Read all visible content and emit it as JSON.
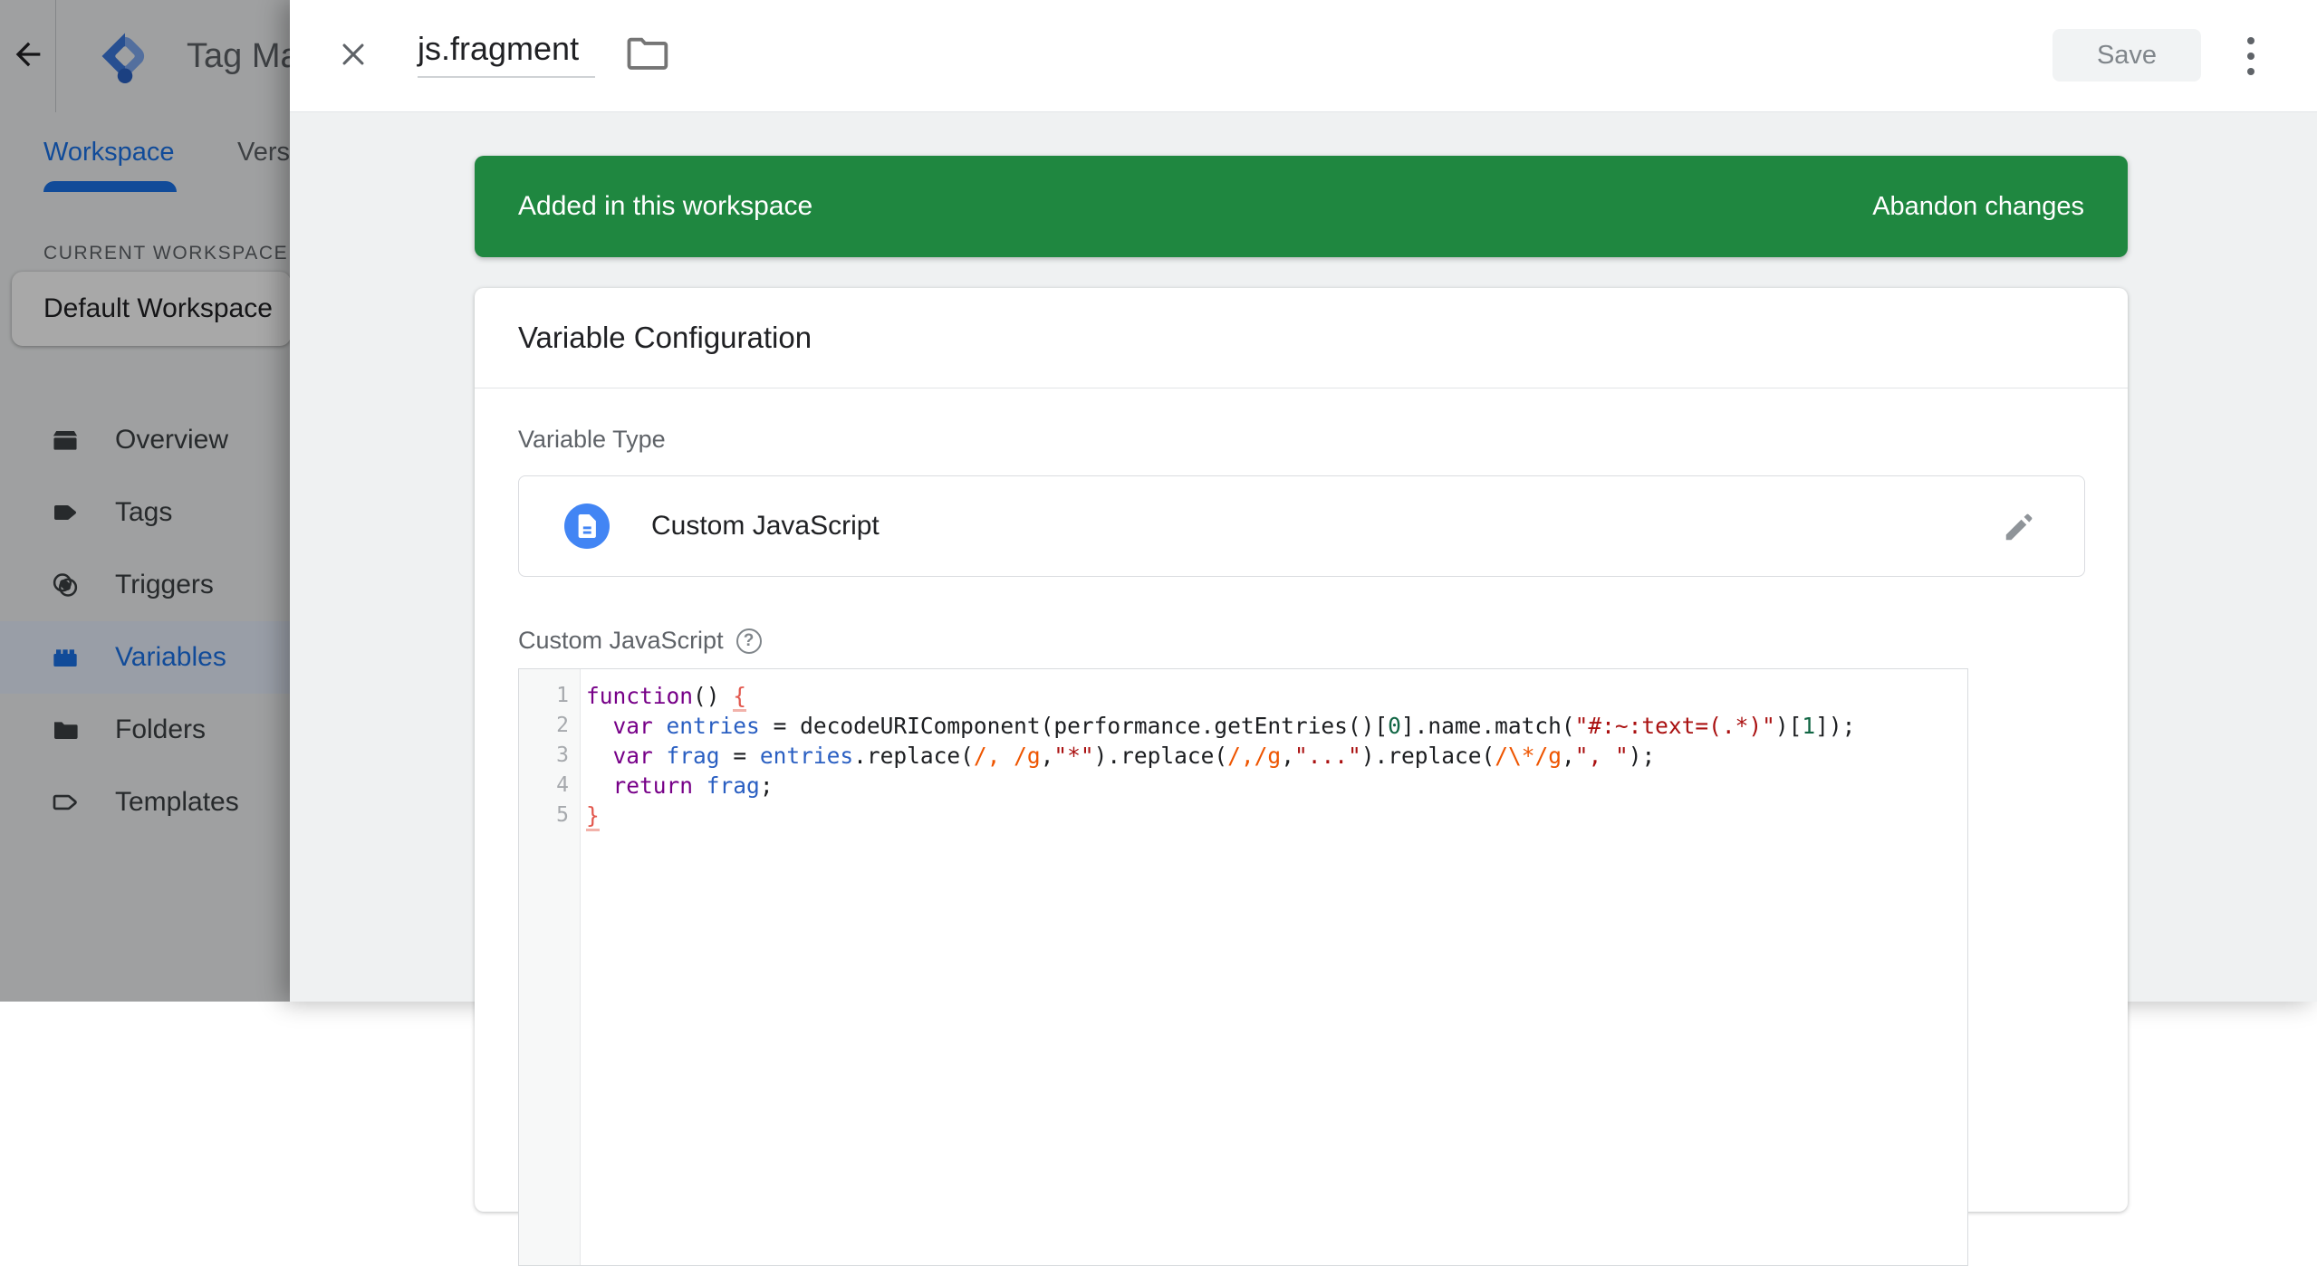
{
  "app": {
    "title": "Tag Ma",
    "tabs": [
      {
        "label": "Workspace",
        "active": true
      },
      {
        "label": "Vers",
        "active": false
      }
    ],
    "sidebar": {
      "section_label": "CURRENT WORKSPACE",
      "workspace_name": "Default Workspace",
      "items": [
        {
          "label": "Overview",
          "selected": false
        },
        {
          "label": "Tags",
          "selected": false
        },
        {
          "label": "Triggers",
          "selected": false
        },
        {
          "label": "Variables",
          "selected": true
        },
        {
          "label": "Folders",
          "selected": false
        },
        {
          "label": "Templates",
          "selected": false
        }
      ]
    }
  },
  "panel": {
    "title": "js.fragment",
    "save_label": "Save",
    "banner": {
      "message": "Added in this workspace",
      "action_label": "Abandon changes"
    },
    "card_title": "Variable Configuration",
    "variable_type": {
      "label": "Variable Type",
      "value": "Custom JavaScript"
    },
    "editor": {
      "label": "Custom JavaScript",
      "lines": [
        {
          "num": 1,
          "tokens": [
            [
              "k",
              "function"
            ],
            [
              "p",
              "() "
            ],
            [
              "b",
              "{"
            ]
          ]
        },
        {
          "num": 2,
          "tokens": [
            [
              "p",
              "  "
            ],
            [
              "k",
              "var"
            ],
            [
              "p",
              " "
            ],
            [
              "v",
              "entries"
            ],
            [
              "p",
              " = decodeURIComponent(performance.getEntries()["
            ],
            [
              "n",
              "0"
            ],
            [
              "p",
              "].name.match("
            ],
            [
              "s",
              "\"#:~:text=(.*)\""
            ],
            [
              "p",
              ")["
            ],
            [
              "n",
              "1"
            ],
            [
              "p",
              "]);"
            ]
          ]
        },
        {
          "num": 3,
          "tokens": [
            [
              "p",
              "  "
            ],
            [
              "k",
              "var"
            ],
            [
              "p",
              " "
            ],
            [
              "v",
              "frag"
            ],
            [
              "p",
              " = "
            ],
            [
              "v",
              "entries"
            ],
            [
              "p",
              ".replace("
            ],
            [
              "r",
              "/, /g"
            ],
            [
              "p",
              ","
            ],
            [
              "s",
              "\"*\""
            ],
            [
              "p",
              ").replace("
            ],
            [
              "r",
              "/,/g"
            ],
            [
              "p",
              ","
            ],
            [
              "s",
              "\"...\""
            ],
            [
              "p",
              ").replace("
            ],
            [
              "r",
              "/\\*/g"
            ],
            [
              "p",
              ","
            ],
            [
              "s",
              "\", \""
            ],
            [
              "p",
              ");"
            ]
          ]
        },
        {
          "num": 4,
          "tokens": [
            [
              "p",
              "  "
            ],
            [
              "k",
              "return"
            ],
            [
              "p",
              " "
            ],
            [
              "v",
              "frag"
            ],
            [
              "p",
              ";"
            ]
          ]
        },
        {
          "num": 5,
          "tokens": [
            [
              "b",
              "}"
            ]
          ]
        }
      ]
    }
  },
  "colors": {
    "accent_blue": "#1a73e8",
    "banner_green": "#1f8740",
    "type_icon_blue": "#4285f4",
    "code_keyword": "#770088",
    "code_variable": "#2a5fc2",
    "code_string": "#aa1111",
    "code_regex": "#ee5500",
    "code_number": "#116644",
    "code_bracket": "#e2574d"
  }
}
